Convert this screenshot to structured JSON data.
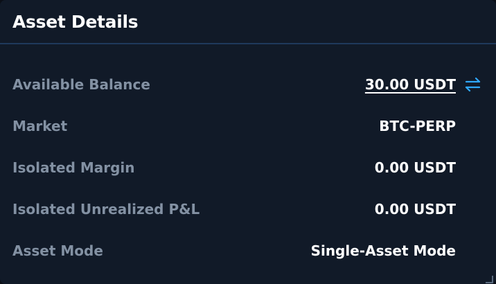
{
  "panel": {
    "title": "Asset Details"
  },
  "rows": [
    {
      "label": "Available Balance",
      "value": "30.00 USDT"
    },
    {
      "label": "Market",
      "value": "BTC-PERP"
    },
    {
      "label": "Isolated Margin",
      "value": "0.00 USDT"
    },
    {
      "label": "Isolated Unrealized P&L",
      "value": "0.00 USDT"
    },
    {
      "label": "Asset Mode",
      "value": "Single-Asset Mode"
    }
  ],
  "icons": {
    "transfer": "transfer-arrows-icon",
    "resize": "resize-handle-icon"
  },
  "colors": {
    "background": "#111a28",
    "label": "#8391a3",
    "value": "#ffffff",
    "accent": "#2fa8ff",
    "divider": "#1f3a5c"
  }
}
